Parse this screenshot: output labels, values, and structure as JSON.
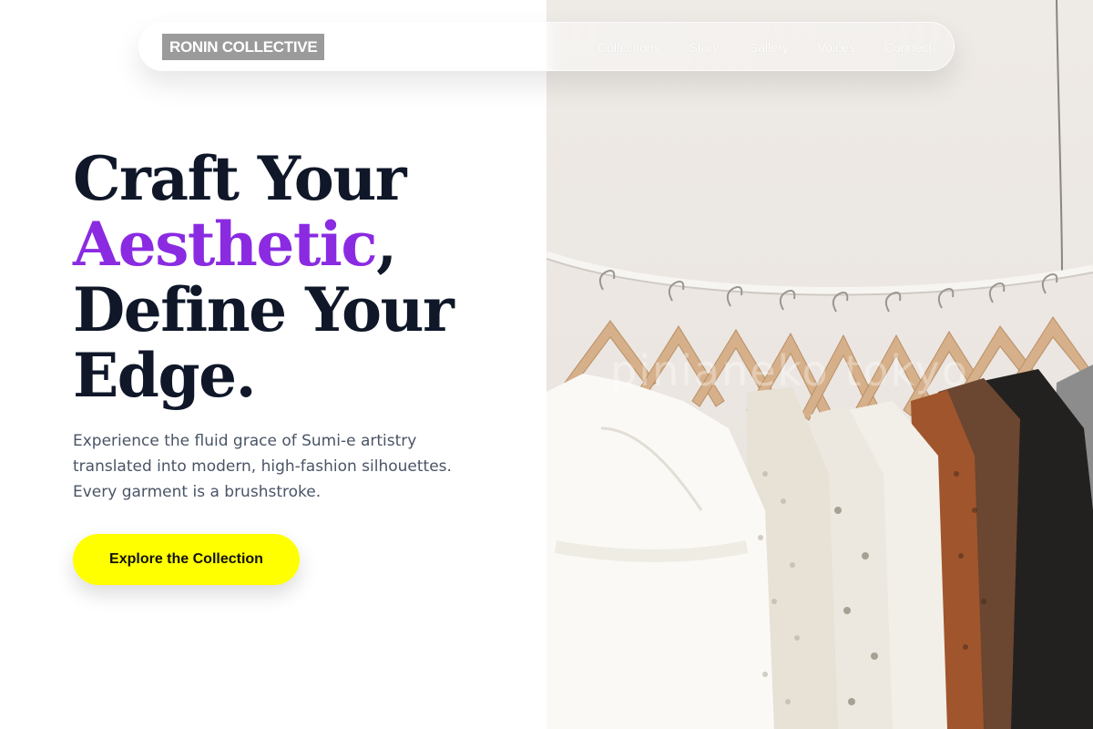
{
  "brand": {
    "logo_text": "RONIN COLLECTIVE"
  },
  "nav": {
    "links": [
      {
        "label": "Collections"
      },
      {
        "label": "Story"
      },
      {
        "label": "Gallery"
      },
      {
        "label": "Voices"
      },
      {
        "label": "Connect"
      }
    ]
  },
  "hero": {
    "title_line1": "Craft Your",
    "title_accent": "Aesthetic",
    "title_comma": ",",
    "title_line3": "Define Your",
    "title_line4": "Edge.",
    "description": "Experience the fluid grace of Sumi-e artistry translated into modern, high-fashion silhouettes. Every garment is a brushstroke.",
    "cta_label": "Explore the Collection"
  },
  "image": {
    "watermark": "pinianeko tokyo"
  },
  "colors": {
    "accent_purple": "#8a2be2",
    "cta_yellow": "#ffff00",
    "heading_navy": "#0f1729",
    "body_gray": "#4a5466",
    "logo_bg": "#9b9b9b"
  }
}
